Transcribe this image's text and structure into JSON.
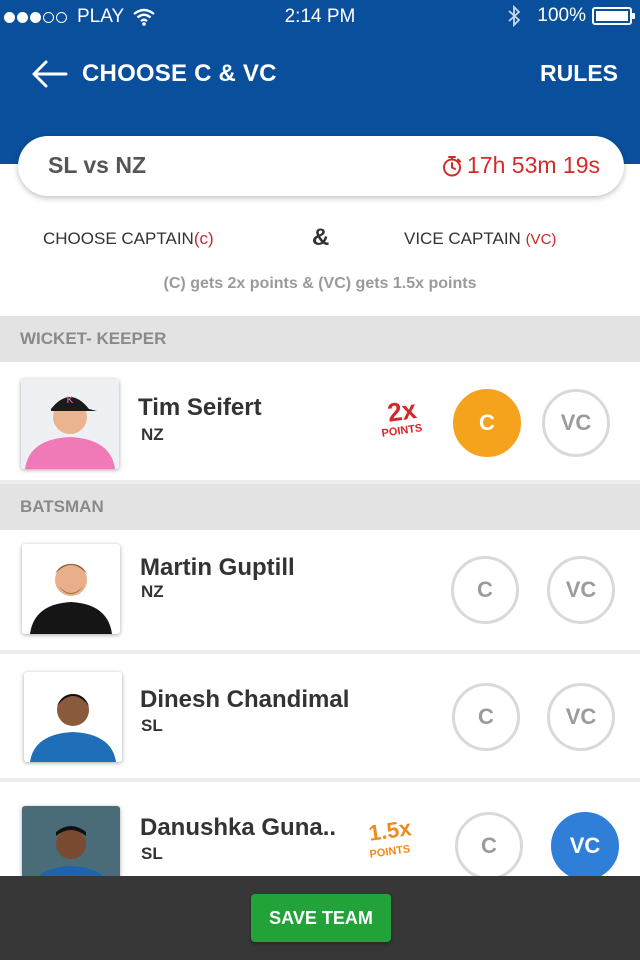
{
  "status_bar": {
    "carrier": "PLAY",
    "time": "2:14 PM",
    "battery": "100%"
  },
  "header": {
    "title": "CHOOSE C & VC",
    "rules_label": "RULES"
  },
  "match": {
    "name": "SL vs NZ",
    "timer": "17h 53m 19s"
  },
  "choose": {
    "captain_label": "CHOOSE CAPTAIN",
    "captain_tag": "(c)",
    "ampersand": "&",
    "vice_label": "VICE CAPTAIN",
    "vice_tag": "(VC)",
    "points_note": "(C) gets 2x points & (VC) gets 1.5x points"
  },
  "sections": {
    "wicket_keeper": "WICKET- KEEPER",
    "batsman": "BATSMAN"
  },
  "players": [
    {
      "name": "Tim Seifert",
      "team": "NZ",
      "badge": "2x",
      "badge_sub": "POINTS",
      "selected": "C"
    },
    {
      "name": "Martin Guptill",
      "team": "NZ",
      "selected": ""
    },
    {
      "name": "Dinesh Chandimal",
      "team": "SL",
      "selected": ""
    },
    {
      "name": "Danushka Guna..",
      "team": "SL",
      "badge": "1.5x",
      "badge_sub": "POINTS",
      "selected": "VC"
    }
  ],
  "buttons": {
    "c": "C",
    "vc": "VC"
  },
  "footer": {
    "save_label": "SAVE TEAM"
  },
  "colors": {
    "header_bg": "#0a4f9b",
    "captain_active": "#f5a31d",
    "vice_active": "#2f7ed8",
    "save_button": "#21a33a",
    "timer": "#d62a2a"
  }
}
